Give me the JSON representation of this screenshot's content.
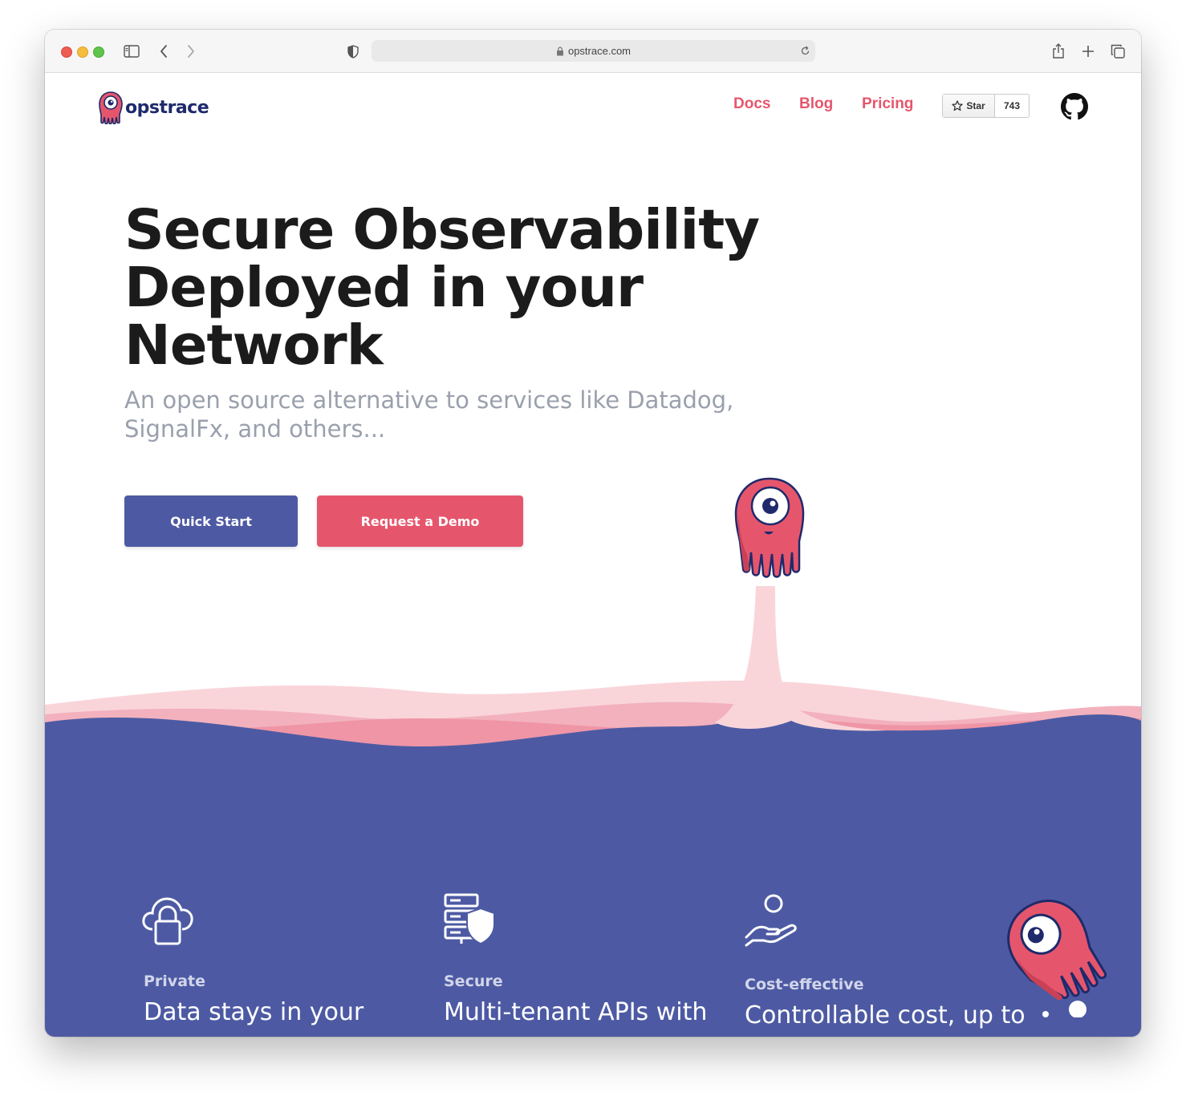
{
  "browser": {
    "url": "opstrace.com",
    "traffic_light_colors": [
      "#ee5d52",
      "#f6bd3c",
      "#5fc54a"
    ]
  },
  "nav": {
    "logo_text": "opstrace",
    "links": [
      "Docs",
      "Blog",
      "Pricing"
    ],
    "star_label": "Star",
    "star_count": "743"
  },
  "hero": {
    "title_lines": [
      "Secure Observability",
      "Deployed in your",
      "Network"
    ],
    "subtitle": "An open source alternative to services like Datadog, SignalFx, and others...",
    "quick_start": "Quick Start",
    "request_demo": "Request a Demo"
  },
  "features": [
    {
      "label": "Private",
      "text": "Data stays in your",
      "icon": "cloud-lock-icon"
    },
    {
      "label": "Secure",
      "text": "Multi-tenant APIs with",
      "icon": "server-shield-icon"
    },
    {
      "label": "Cost-effective",
      "text": "Controllable cost, up to",
      "icon": "hand-coin-icon"
    }
  ],
  "colors": {
    "brand_pink": "#e5566d",
    "brand_indigo": "#4d5aa3",
    "text_dark": "#1b1b1b",
    "text_muted": "#9aa0ac"
  }
}
